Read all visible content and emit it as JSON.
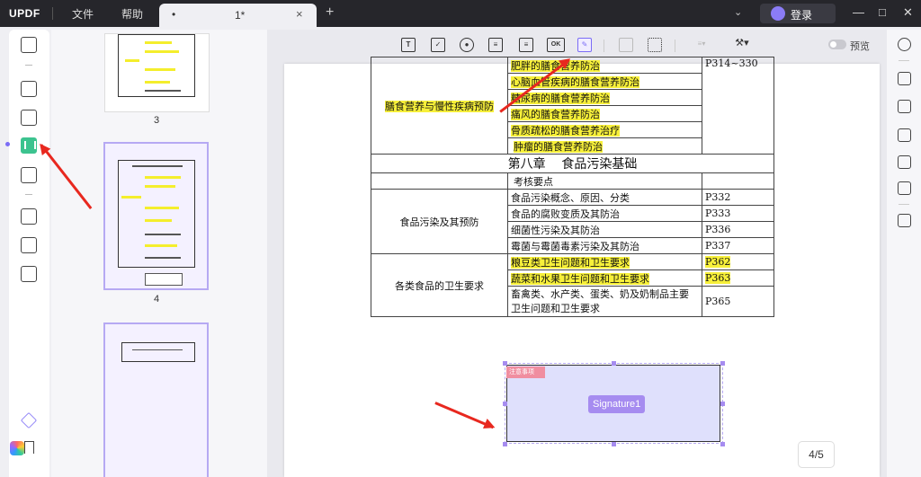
{
  "titlebar": {
    "logo": "UPDF",
    "menu_file": "文件",
    "menu_help": "帮助",
    "tab_dot": "•",
    "tab_name": "1*",
    "tab_close": "×",
    "new_tab": "+",
    "login": "登录"
  },
  "thumbnails": [
    {
      "page": "3"
    },
    {
      "page": "4"
    }
  ],
  "toolbar": {
    "text_field": "T",
    "ok_button": "OK",
    "preview_label": "预览"
  },
  "table": {
    "top_rows": [
      {
        "text": "肥胖的膳食营养防治",
        "highlight": true
      },
      {
        "text": "心脑血管疾病的膳食营养防治",
        "highlight": true
      },
      {
        "text": "糖尿病的膳食营养防治",
        "highlight": true
      },
      {
        "text": "痛风的膳食营养防治",
        "highlight": true
      },
      {
        "text": "骨质疏松的膳食营养治疗",
        "highlight": true
      },
      {
        "text": "肿瘤的膳食营养防治",
        "highlight": true
      }
    ],
    "top_left": "膳食营养与慢性疾病预防",
    "top_page": "P314~330",
    "chapter": "第八章    食品污染基础",
    "exam_points": "考核要点",
    "group1_label": "食品污染及其预防",
    "group1_rows": [
      {
        "text": "食品污染概念、原因、分类",
        "page": "P332",
        "highlight": false
      },
      {
        "text": "食品的腐败变质及其防治",
        "page": "P333",
        "highlight": false
      },
      {
        "text": "细菌性污染及其防治",
        "page": "P336",
        "highlight": false
      },
      {
        "text": "霉菌与霉菌毒素污染及其防治",
        "page": "P337",
        "highlight": false
      }
    ],
    "group2_label": "各类食品的卫生要求",
    "group2_rows": [
      {
        "text": "粮豆类卫生问题和卫生要求",
        "page": "P362",
        "highlight": true
      },
      {
        "text": "蔬菜和水果卫生问题和卫生要求",
        "page": "P363",
        "highlight": true
      }
    ],
    "group2_last_line1": "畜禽类、水产类、蛋类、奶及奶制品主要",
    "group2_last_line2": "卫生问题和卫生要求",
    "group2_last_page": "P365"
  },
  "signature": {
    "label": "Signature1",
    "tag": "注意事项"
  },
  "page_indicator": "4/5",
  "colors": {
    "accent": "#7b6cf6",
    "highlight": "#f7f03a",
    "arrow": "#e8281f",
    "active_tool": "#3cc38f"
  }
}
